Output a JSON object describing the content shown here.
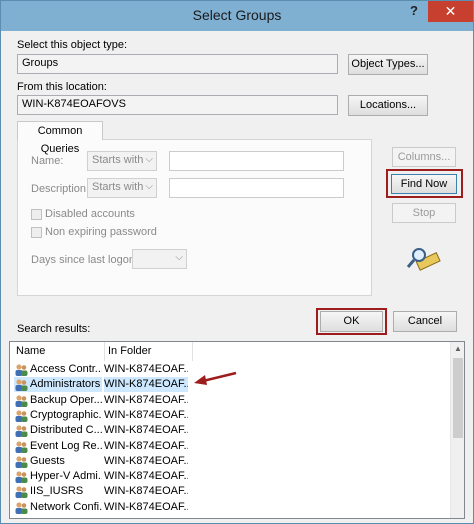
{
  "window": {
    "title": "Select Groups",
    "help_label": "?",
    "close_label": "✕"
  },
  "object_type": {
    "label": "Select this object type:",
    "value": "Groups",
    "button": "Object Types..."
  },
  "location": {
    "label": "From this location:",
    "value": "WIN-K874EOAFOVS",
    "button": "Locations..."
  },
  "common_queries": {
    "tab": "Common Queries",
    "name_label": "Name:",
    "name_mode": "Starts with",
    "description_label": "Description:",
    "description_mode": "Starts with",
    "disabled_accounts": "Disabled accounts",
    "non_expiring_password": "Non expiring password",
    "days_label": "Days since last logon:"
  },
  "side_buttons": {
    "columns": "Columns...",
    "find_now": "Find Now",
    "stop": "Stop"
  },
  "dialog_buttons": {
    "ok": "OK",
    "cancel": "Cancel"
  },
  "results": {
    "label": "Search results:",
    "columns": [
      "Name",
      "In Folder"
    ],
    "rows": [
      {
        "name": "Access Contr...",
        "folder": "WIN-K874EOAF..."
      },
      {
        "name": "Administrators",
        "folder": "WIN-K874EOAF..."
      },
      {
        "name": "Backup Oper...",
        "folder": "WIN-K874EOAF..."
      },
      {
        "name": "Cryptographic...",
        "folder": "WIN-K874EOAF..."
      },
      {
        "name": "Distributed C...",
        "folder": "WIN-K874EOAF..."
      },
      {
        "name": "Event Log Re...",
        "folder": "WIN-K874EOAF..."
      },
      {
        "name": "Guests",
        "folder": "WIN-K874EOAF..."
      },
      {
        "name": "Hyper-V Admi...",
        "folder": "WIN-K874EOAF..."
      },
      {
        "name": "IIS_IUSRS",
        "folder": "WIN-K874EOAF..."
      },
      {
        "name": "Network Confi...",
        "folder": "WIN-K874EOAF..."
      }
    ]
  },
  "colors": {
    "highlight": "#9d1c1c",
    "selection": "#cde8ff",
    "titlebar": "#7fb0d2",
    "close": "#c7402f"
  },
  "icons": {
    "search": "search-icon",
    "group": "group-icon",
    "arrow": "red-arrow-icon"
  }
}
